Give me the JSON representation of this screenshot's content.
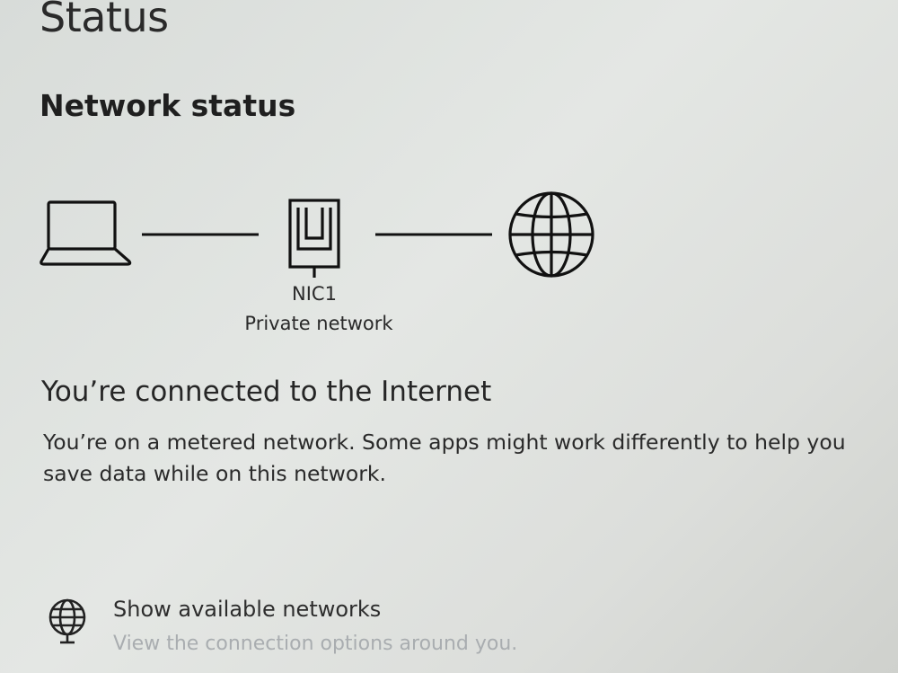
{
  "header": {
    "title": "Status"
  },
  "network_status": {
    "section_title": "Network status",
    "adapter_name": "NIC1",
    "network_type": "Private network",
    "icons": [
      "laptop-icon",
      "ethernet-adapter-icon",
      "globe-icon"
    ]
  },
  "connection": {
    "heading": "You’re connected to the Internet",
    "description": "You’re on a metered network. Some apps might work differently to help you save data while on this network."
  },
  "available_networks": {
    "title": "Show available networks",
    "subtitle": "View the connection options around you.",
    "icon": "network-globe-icon"
  }
}
